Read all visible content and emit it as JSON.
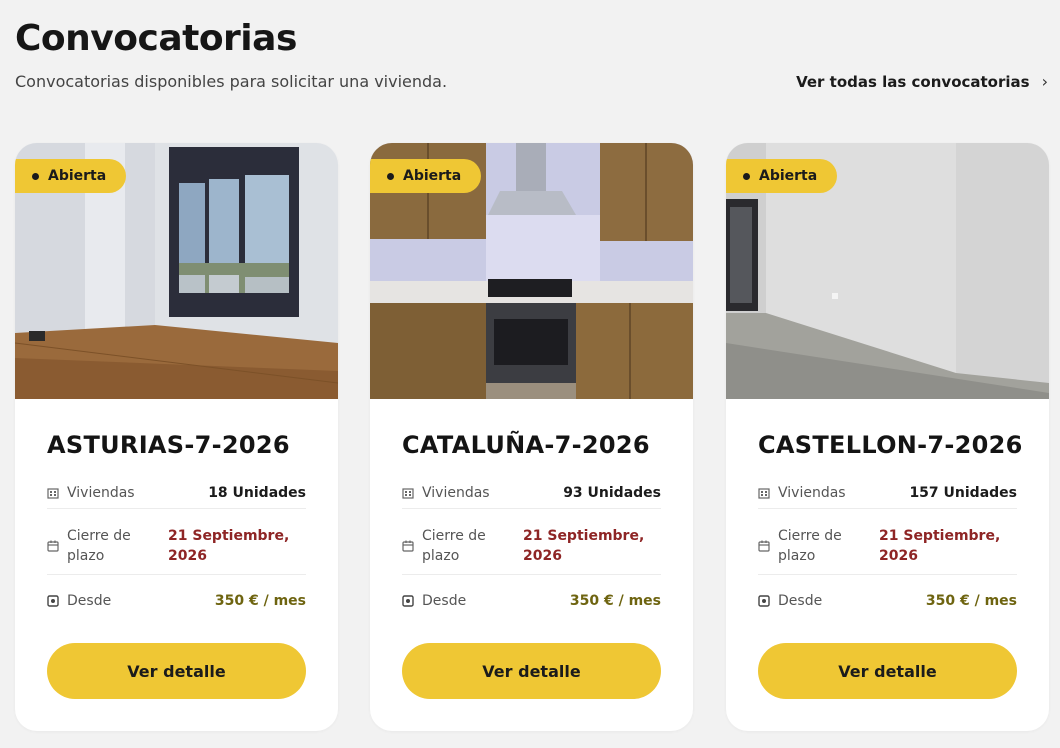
{
  "header": {
    "title": "Convocatorias",
    "subtitle": "Convocatorias disponibles para solicitar una vivienda.",
    "see_all": "Ver todas las convocatorias",
    "see_all_icon": "›"
  },
  "colors": {
    "accent": "#efc734",
    "deadline": "#8e2525",
    "price": "#6e6410"
  },
  "labels": {
    "viviendas": "Viviendas",
    "cierre": "Cierre de plazo",
    "desde": "Desde",
    "button": "Ver detalle"
  },
  "cards": [
    {
      "status": "Abierta",
      "title": "ASTURIAS-7-2026",
      "units": "18 Unidades",
      "deadline": "21 Septiembre, 2026",
      "price": "350 € / mes",
      "photo": "empty-living-room-with-window"
    },
    {
      "status": "Abierta",
      "title": "CATALUÑA-7-2026",
      "units": "93 Unidades",
      "deadline": "21 Septiembre, 2026",
      "price": "350 € / mes",
      "photo": "kitchen-with-hood-and-oven"
    },
    {
      "status": "Abierta",
      "title": "CASTELLON-7-2026",
      "units": "157 Unidades",
      "deadline": "21 Septiembre, 2026",
      "price": "350 € / mes",
      "photo": "empty-room-with-door"
    }
  ]
}
